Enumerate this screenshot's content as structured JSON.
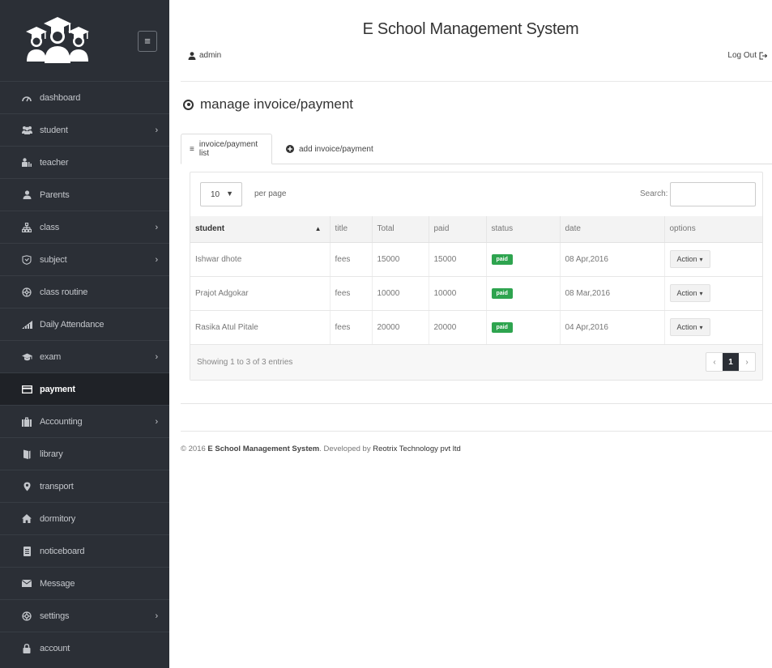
{
  "app": {
    "title": "E School Management System"
  },
  "header": {
    "user": "admin",
    "logout": "Log Out"
  },
  "sidebar": {
    "toggle_icon": "hamburger-icon",
    "items": [
      {
        "label": "dashboard",
        "icon": "dashboard-icon",
        "has_submenu": false,
        "active": false
      },
      {
        "label": "student",
        "icon": "users-icon",
        "has_submenu": true,
        "active": false
      },
      {
        "label": "teacher",
        "icon": "teacher-icon",
        "has_submenu": false,
        "active": false
      },
      {
        "label": "Parents",
        "icon": "user-icon",
        "has_submenu": false,
        "active": false
      },
      {
        "label": "class",
        "icon": "sitemap-icon",
        "has_submenu": true,
        "active": false
      },
      {
        "label": "subject",
        "icon": "subject-icon",
        "has_submenu": true,
        "active": false
      },
      {
        "label": "class routine",
        "icon": "routine-icon",
        "has_submenu": false,
        "active": false
      },
      {
        "label": "Daily Attendance",
        "icon": "bar-chart-icon",
        "has_submenu": false,
        "active": false
      },
      {
        "label": "exam",
        "icon": "graduation-cap-icon",
        "has_submenu": true,
        "active": false
      },
      {
        "label": "payment",
        "icon": "credit-card-icon",
        "has_submenu": false,
        "active": true
      },
      {
        "label": "Accounting",
        "icon": "briefcase-icon",
        "has_submenu": true,
        "active": false
      },
      {
        "label": "library",
        "icon": "book-icon",
        "has_submenu": false,
        "active": false
      },
      {
        "label": "transport",
        "icon": "map-marker-icon",
        "has_submenu": false,
        "active": false
      },
      {
        "label": "dormitory",
        "icon": "home-icon",
        "has_submenu": false,
        "active": false
      },
      {
        "label": "noticeboard",
        "icon": "clipboard-icon",
        "has_submenu": false,
        "active": false
      },
      {
        "label": "Message",
        "icon": "envelope-icon",
        "has_submenu": false,
        "active": false
      },
      {
        "label": "settings",
        "icon": "settings-icon",
        "has_submenu": true,
        "active": false
      },
      {
        "label": "account",
        "icon": "lock-icon",
        "has_submenu": false,
        "active": false
      }
    ]
  },
  "page": {
    "heading": "manage invoice/payment"
  },
  "tabs": [
    {
      "label": "invoice/payment list",
      "icon": "list-icon",
      "active": true
    },
    {
      "label": "add invoice/payment",
      "icon": "plus-circle-icon",
      "active": false
    }
  ],
  "table": {
    "page_length": "10",
    "per_page_label": "per page",
    "search_label": "Search:",
    "search_value": "",
    "columns": [
      "student",
      "title",
      "Total",
      "paid",
      "status",
      "date",
      "options"
    ],
    "rows": [
      {
        "student": "Ishwar dhote",
        "title": "fees",
        "total": "15000",
        "paid": "15000",
        "status": "paid",
        "date": "08 Apr,2016",
        "action": "Action"
      },
      {
        "student": "Prajot Adgokar",
        "title": "fees",
        "total": "10000",
        "paid": "10000",
        "status": "paid",
        "date": "08 Mar,2016",
        "action": "Action"
      },
      {
        "student": "Rasika Atul Pitale",
        "title": "fees",
        "total": "20000",
        "paid": "20000",
        "status": "paid",
        "date": "04 Apr,2016",
        "action": "Action"
      }
    ],
    "info": "Showing 1 to 3 of 3 entries",
    "pager": {
      "prev": "‹",
      "current": "1",
      "next": "›"
    }
  },
  "footer": {
    "prefix": "© 2016 ",
    "brand": "E School Management System",
    "middle": ". Developed by ",
    "company": "Reotrix Technology pvt ltd"
  },
  "colors": {
    "sidebar": "#2b2f36",
    "active_item": "#1f2227",
    "paid_badge": "#2ea44f"
  }
}
